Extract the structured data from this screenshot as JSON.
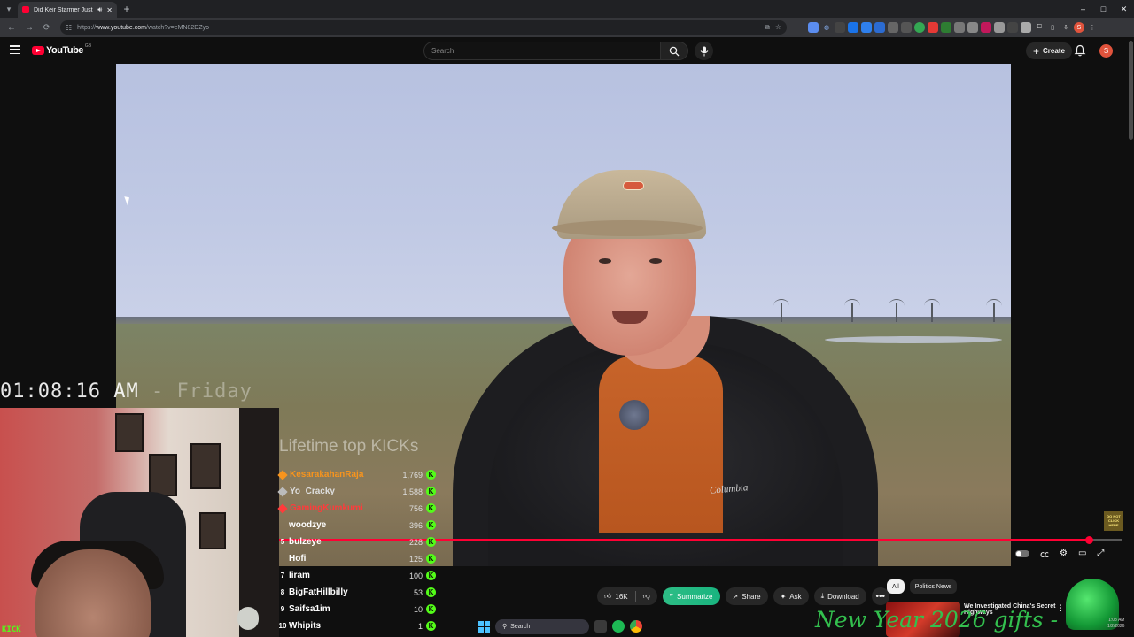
{
  "browser": {
    "tab_title": "Did Keir Starmer Just Comm",
    "url_prefix": "https://",
    "url_host": "www.youtube.com",
    "url_path": "/watch?v=eMN82DZyo",
    "min_glyph": "–",
    "max_glyph": "□",
    "close_glyph": "✕"
  },
  "youtube": {
    "logo_text": "YouTube",
    "logo_country": "GB",
    "search_placeholder": "Search",
    "create_label": "Create",
    "avatar_letter": "S"
  },
  "overlay": {
    "clock_time": "01:08:16 AM",
    "clock_day": "- Friday",
    "kicks_title": "Lifetime top KICKs",
    "kick_brand": "KICK",
    "not_click_sign": "DO NOT CLICK HERE",
    "leaderboard": [
      {
        "rank": "",
        "name": "KesarakahanRaja",
        "count": "1,769",
        "color": "#f7941d",
        "diamond": "#f7941d"
      },
      {
        "rank": "",
        "name": "Yo_Cracky",
        "count": "1,588",
        "color": "#dddddd",
        "diamond": "#bbbbbb"
      },
      {
        "rank": "",
        "name": "GamingKumkumi",
        "count": "756",
        "color": "#ff3b3b",
        "diamond": "#ff3b3b"
      },
      {
        "rank": "",
        "name": "woodzye",
        "count": "396",
        "color": "#ffffff",
        "diamond": ""
      },
      {
        "rank": "5",
        "name": "bulzeye",
        "count": "228",
        "color": "#ffffff",
        "diamond": ""
      },
      {
        "rank": "",
        "name": "Hofi",
        "count": "125",
        "color": "#ffffff",
        "diamond": ""
      },
      {
        "rank": "7",
        "name": "liram",
        "count": "100",
        "color": "#ffffff",
        "diamond": ""
      },
      {
        "rank": "8",
        "name": "BigFatHillbilly",
        "count": "53",
        "color": "#ffffff",
        "diamond": ""
      },
      {
        "rank": "9",
        "name": "Saifsa1im",
        "count": "10",
        "color": "#ffffff",
        "diamond": ""
      },
      {
        "rank": "10",
        "name": "Whipits",
        "count": "1",
        "color": "#ffffff",
        "diamond": ""
      }
    ],
    "new_year_banner": "New Year 2026 gifts -"
  },
  "video": {
    "jacket_brand": "Columbia",
    "progress_fraction": 0.96
  },
  "actions": {
    "like_count": "16K",
    "summarize_label": "Summarize",
    "share_label": "Share",
    "ask_label": "Ask",
    "download_label": "Download",
    "more_glyph": "•••"
  },
  "chips": [
    "All",
    "Politics News"
  ],
  "recommendation": {
    "title": "We Investigated China's Secret Highways"
  },
  "taskbar": {
    "search_label": "Search",
    "tray_time": "1:08 AM",
    "tray_date": "1/2/2026"
  },
  "colors": {
    "accent_red": "#ff0033",
    "kick_green": "#53fc18",
    "summarize_green": "#19b47f"
  }
}
